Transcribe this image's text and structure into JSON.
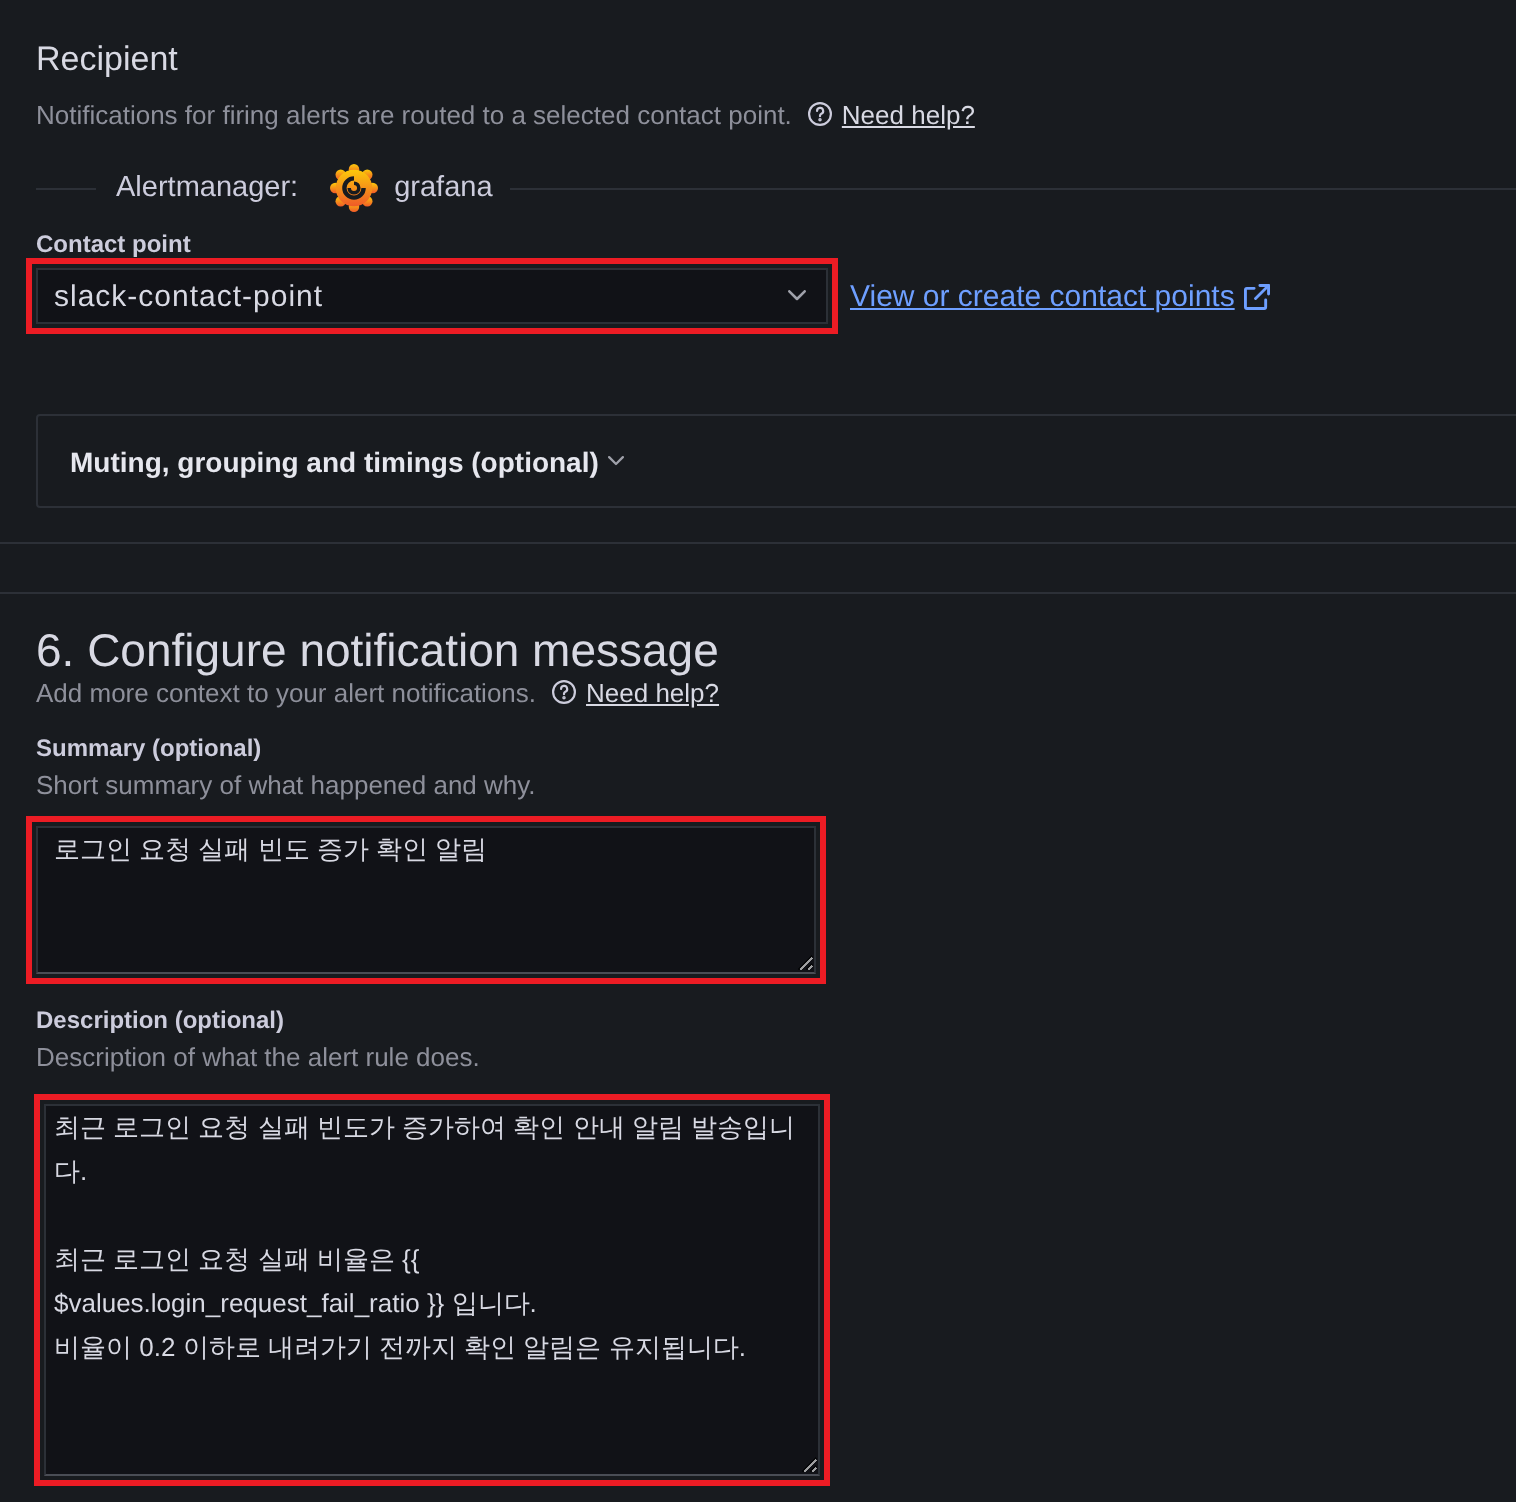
{
  "recipient": {
    "title": "Recipient",
    "description": "Notifications for firing alerts are routed to a selected contact point.",
    "help_link": "Need help?",
    "alertmanager": {
      "label": "Alertmanager:",
      "name": "grafana"
    },
    "contact_point": {
      "label": "Contact point",
      "value": "slack-contact-point",
      "highlighted": true
    },
    "contact_points_link": "View or create contact points",
    "options_section": {
      "title": "Muting, grouping and timings (optional)",
      "expanded": false
    }
  },
  "notification_message": {
    "title": "6. Configure notification message",
    "description": "Add more context to your alert notifications.",
    "help_link": "Need help?",
    "fields": [
      {
        "label": "Summary (optional)",
        "hint": "Short summary of what happened and why.",
        "value": "로그인 요청 실패 빈도 증가 확인 알림",
        "highlighted": true
      },
      {
        "label": "Description (optional)",
        "hint": "Description of what the alert rule does.",
        "value": "최근 로그인 요청 실패 빈도가 증가하여 확인 안내 알림 발송입니\n다.\n\n최근 로그인 요청 실패 비율은 {{\n$values.login_request_fail_ratio }} 입니다.\n비율이 0.2 이하로 내려가기 전까지 확인 알림은 유지됩니다.",
        "highlighted": true
      }
    ]
  }
}
